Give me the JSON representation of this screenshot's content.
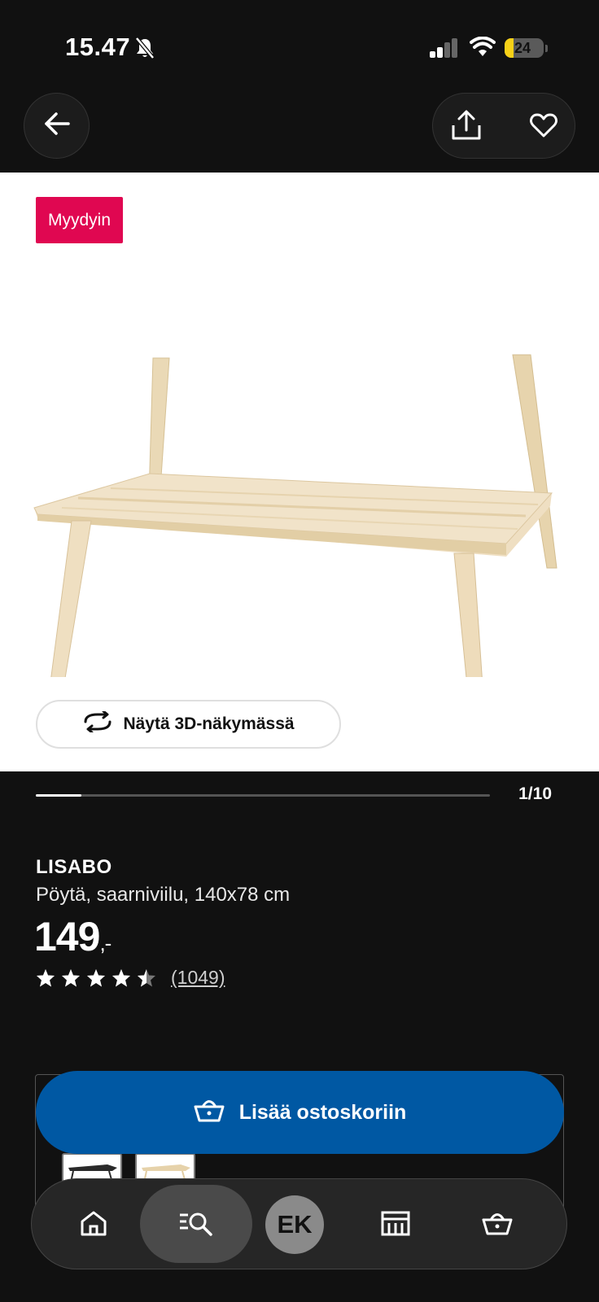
{
  "status_bar": {
    "time": "15.47",
    "battery": "24",
    "icons": [
      "bell-slash-icon",
      "signal-icon",
      "wifi-icon",
      "battery-icon"
    ]
  },
  "header": {
    "icons": [
      "arrow-left-icon",
      "share-icon",
      "heart-icon"
    ]
  },
  "gallery": {
    "badge": "Myydyin",
    "view_3d_label": "Näytä 3D-näkymässä",
    "counter": "1/10",
    "progress": 0.1
  },
  "product": {
    "name": "LISABO",
    "description": "Pöytä, saarniviilu, 140x78 cm",
    "price": "149",
    "price_suffix": ",-",
    "rating": 4.5,
    "review_count": "(1049)"
  },
  "cart": {
    "add_label": "Lisää ostoskoriin"
  },
  "bottom_nav": {
    "avatar_initials": "EK",
    "items": [
      "home-icon",
      "search-icon",
      "avatar",
      "store-icon",
      "basket-icon"
    ]
  },
  "colors": {
    "background": "#111111",
    "badge": "#e00751",
    "primary_button": "#0058a3"
  }
}
